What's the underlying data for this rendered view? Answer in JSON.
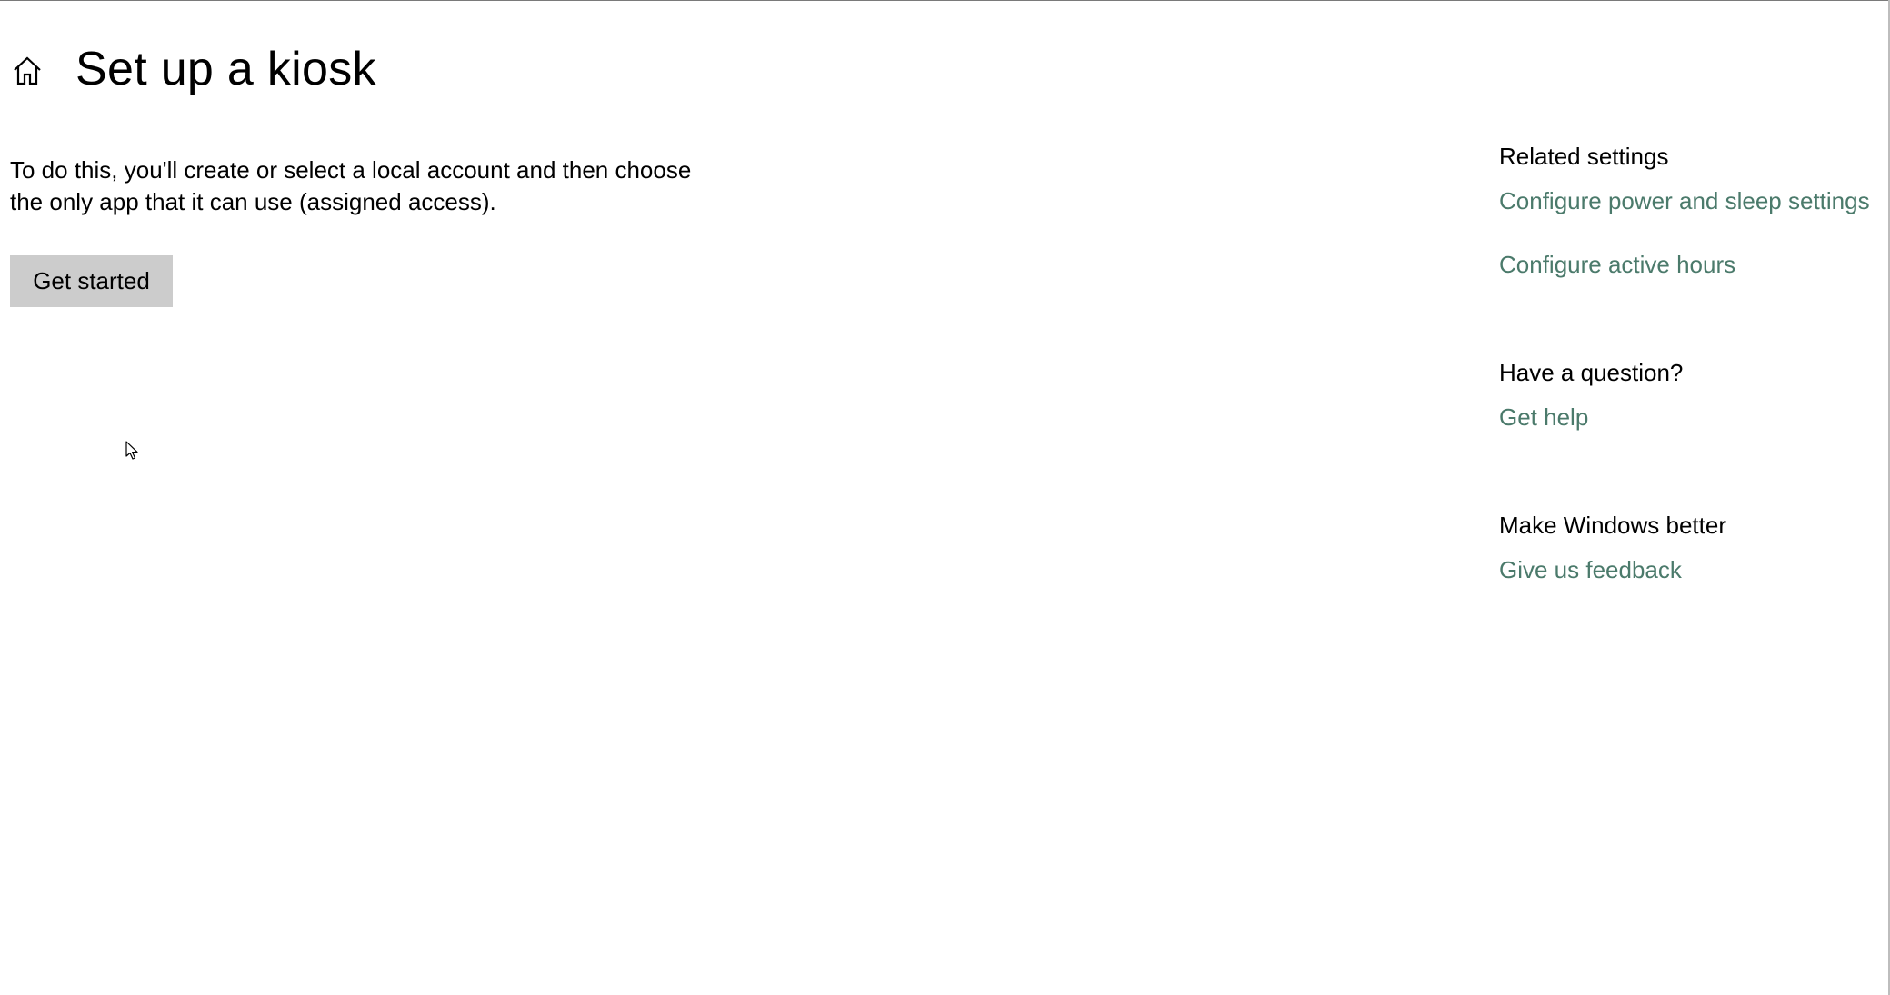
{
  "header": {
    "home_icon": "home-icon",
    "title": "Set up a kiosk"
  },
  "main": {
    "description_line1": "To do this, you'll create or select a local account and then choose",
    "description_line2": "the only app that it can use (assigned access).",
    "get_started_label": "Get started"
  },
  "sidebar": {
    "related_settings": {
      "heading": "Related settings",
      "links": [
        "Configure power and sleep settings",
        "Configure active hours"
      ]
    },
    "question": {
      "heading": "Have a question?",
      "link": "Get help"
    },
    "feedback": {
      "heading": "Make Windows better",
      "link": "Give us feedback"
    }
  },
  "colors": {
    "link": "#4b7a6b",
    "button_bg": "#cccccc",
    "background": "#ffffff"
  }
}
